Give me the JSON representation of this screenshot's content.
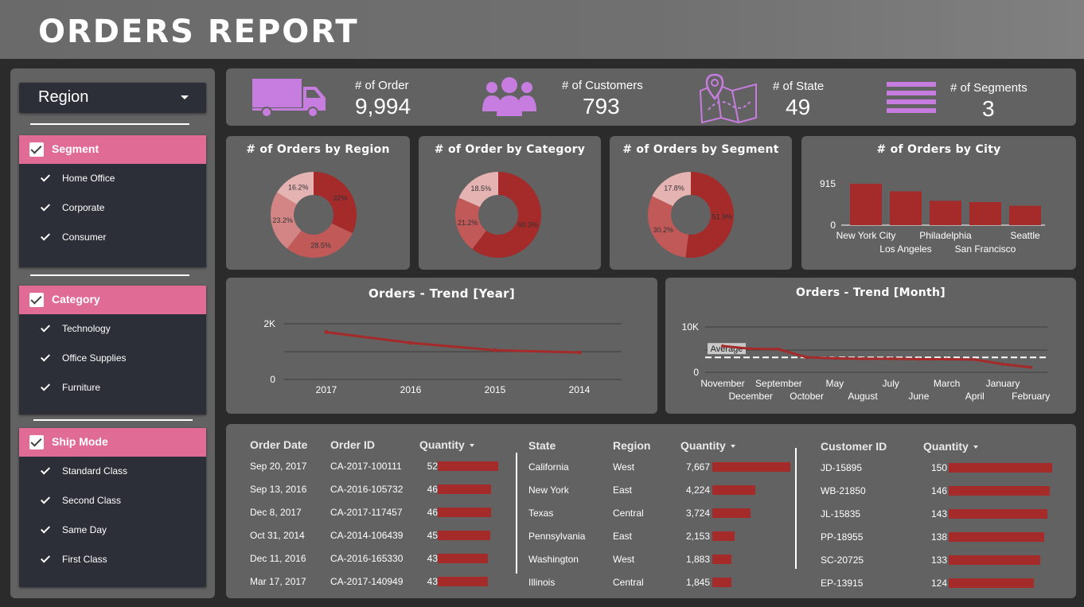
{
  "header": {
    "title": "ORDERS REPORT"
  },
  "sidebar": {
    "region_dropdown": {
      "label": "Region"
    },
    "filters": [
      {
        "title": "Segment",
        "items": [
          "Home Office",
          "Corporate",
          "Consumer"
        ]
      },
      {
        "title": "Category",
        "items": [
          "Technology",
          "Office Supplies",
          "Furniture"
        ]
      },
      {
        "title": "Ship Mode",
        "items": [
          "Standard Class",
          "Second Class",
          "Same Day",
          "First Class"
        ]
      }
    ]
  },
  "kpis": [
    {
      "label": "# of Order",
      "value": "9,994",
      "icon": "truck-icon"
    },
    {
      "label": "# of Customers",
      "value": "793",
      "icon": "people-icon"
    },
    {
      "label": "# of State",
      "value": "49",
      "icon": "map-pin-icon"
    },
    {
      "label": "# of Segments",
      "value": "3",
      "icon": "bars-icon"
    }
  ],
  "colors": {
    "accent": "#a52a2a",
    "filter_header": "#e06c95",
    "kpi_icon": "#c77ddf",
    "card": "#626262",
    "sidebar_box": "#2c2f38"
  },
  "charts": {
    "region": {
      "title": "# of Orders by Region"
    },
    "category": {
      "title": "# of Order by Category"
    },
    "segment": {
      "title": "# of Orders by Segment"
    },
    "city": {
      "title": "# of Orders by City"
    },
    "trend_year": {
      "title": "Orders - Trend [Year]"
    },
    "trend_month": {
      "title": "Orders - Trend [Month]",
      "average_label": "Average"
    }
  },
  "chart_data": [
    {
      "type": "pie",
      "title": "# of Orders by Region",
      "labels": [
        "32%",
        "28.5%",
        "23.2%",
        "16.2%"
      ],
      "values": [
        32,
        28.5,
        23.2,
        16.2
      ],
      "colors": [
        "#a52a2a",
        "#c25959",
        "#d38585",
        "#e6b3b3"
      ]
    },
    {
      "type": "pie",
      "title": "# of Order by Category",
      "labels": [
        "60.3%",
        "21.2%",
        "18.5%"
      ],
      "values": [
        60.3,
        21.2,
        18.5
      ],
      "colors": [
        "#a52a2a",
        "#c25959",
        "#e6b3b3"
      ]
    },
    {
      "type": "pie",
      "title": "# of Orders by Segment",
      "labels": [
        "51.9%",
        "30.2%",
        "17.8%"
      ],
      "values": [
        51.9,
        30.2,
        17.8
      ],
      "colors": [
        "#a52a2a",
        "#c25959",
        "#e6b3b3"
      ]
    },
    {
      "type": "bar",
      "title": "# of Orders by City",
      "categories": [
        "New York City",
        "Los Angeles",
        "Philadelphia",
        "San Francisco",
        "Seattle"
      ],
      "values": [
        915,
        747,
        537,
        510,
        428
      ],
      "ylim": [
        0,
        915
      ],
      "yticks": [
        "915",
        "0"
      ]
    },
    {
      "type": "line",
      "title": "Orders - Trend [Year]",
      "x": [
        "2017",
        "2016",
        "2015",
        "2014"
      ],
      "values": [
        1700,
        1315,
        1050,
        970
      ],
      "ylim": [
        0,
        2000
      ],
      "yticks": [
        "2K",
        "0"
      ]
    },
    {
      "type": "line",
      "title": "Orders - Trend [Month]",
      "x": [
        "November",
        "December",
        "September",
        "October",
        "May",
        "August",
        "July",
        "June",
        "March",
        "April",
        "January",
        "February"
      ],
      "values": [
        5.8,
        5.2,
        5.1,
        3.3,
        3.1,
        3.0,
        3.0,
        2.9,
        2.9,
        2.8,
        1.8,
        1.1
      ],
      "average": 3.3,
      "ylim": [
        0,
        10
      ],
      "yticks": [
        "10K",
        "0"
      ]
    }
  ],
  "tables": {
    "orders": {
      "headers": [
        "Order Date",
        "Order ID",
        "Quantity"
      ],
      "rows": [
        {
          "date": "Sep 20, 2017",
          "id": "CA-2017-100111",
          "qty": 52
        },
        {
          "date": "Sep 13, 2016",
          "id": "CA-2016-105732",
          "qty": 46
        },
        {
          "date": "Dec 8, 2017",
          "id": "CA-2017-117457",
          "qty": 46
        },
        {
          "date": "Oct 31, 2014",
          "id": "CA-2014-106439",
          "qty": 45
        },
        {
          "date": "Dec 11, 2016",
          "id": "CA-2016-165330",
          "qty": 43
        },
        {
          "date": "Mar 17, 2017",
          "id": "CA-2017-140949",
          "qty": 43
        }
      ]
    },
    "states": {
      "headers": [
        "State",
        "Region",
        "Quantity"
      ],
      "rows": [
        {
          "state": "California",
          "region": "West",
          "qty": "7,667",
          "value": 7667
        },
        {
          "state": "New York",
          "region": "East",
          "qty": "4,224",
          "value": 4224
        },
        {
          "state": "Texas",
          "region": "Central",
          "qty": "3,724",
          "value": 3724
        },
        {
          "state": "Pennsylvania",
          "region": "East",
          "qty": "2,153",
          "value": 2153
        },
        {
          "state": "Washington",
          "region": "West",
          "qty": "1,883",
          "value": 1883
        },
        {
          "state": "Illinois",
          "region": "Central",
          "qty": "1,845",
          "value": 1845
        }
      ]
    },
    "customers": {
      "headers": [
        "Customer ID",
        "Quantity"
      ],
      "rows": [
        {
          "id": "JD-15895",
          "qty": 150
        },
        {
          "id": "WB-21850",
          "qty": 146
        },
        {
          "id": "JL-15835",
          "qty": 143
        },
        {
          "id": "PP-18955",
          "qty": 138
        },
        {
          "id": "SC-20725",
          "qty": 133
        },
        {
          "id": "EP-13915",
          "qty": 124
        }
      ]
    }
  }
}
